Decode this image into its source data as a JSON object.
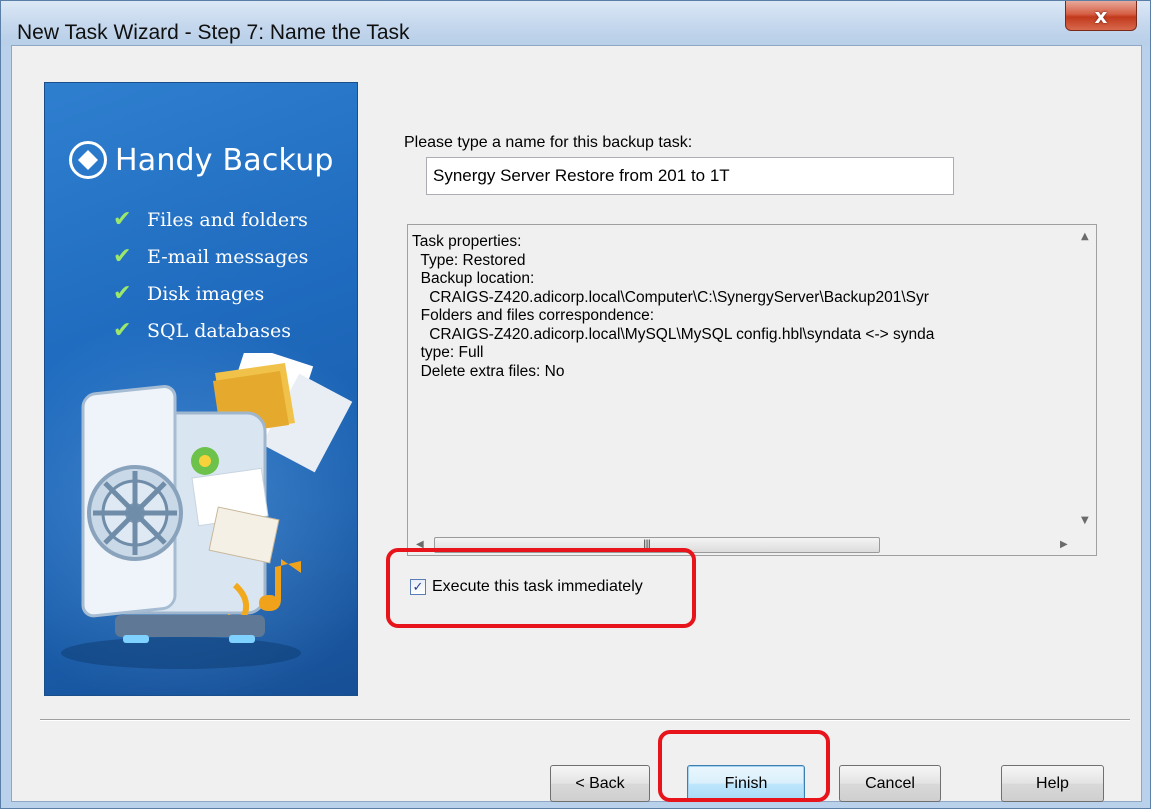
{
  "window": {
    "title": "New Task Wizard - Step 7: Name the Task",
    "close_glyph": "x"
  },
  "banner": {
    "brand": "Handy Backup",
    "features": [
      "Files and folders",
      "E-mail messages",
      "Disk images",
      "SQL databases"
    ],
    "check_glyph": "✔"
  },
  "form": {
    "prompt": "Please type a name for this backup task:",
    "task_name": "Synergy Server Restore from 201 to 1T",
    "properties_lines": [
      "Task properties:",
      "  Type: Restored",
      "  Backup location:",
      "    CRAIGS-Z420.adicorp.local\\Computer\\C:\\SynergyServer\\Backup201\\Syr",
      "  Folders and files correspondence:",
      "    CRAIGS-Z420.adicorp.local\\MySQL\\MySQL config.hbl\\syndata <-> synda",
      "  type: Full",
      "  Delete extra files: No"
    ],
    "execute_label": "Execute this task immediately",
    "execute_checked": true
  },
  "buttons": {
    "back": "< Back",
    "finish": "Finish",
    "cancel": "Cancel",
    "help": "Help"
  },
  "colors": {
    "highlight": "#e8141b",
    "banner_blue": "#1f6bbf",
    "check_green": "#9be86a"
  }
}
